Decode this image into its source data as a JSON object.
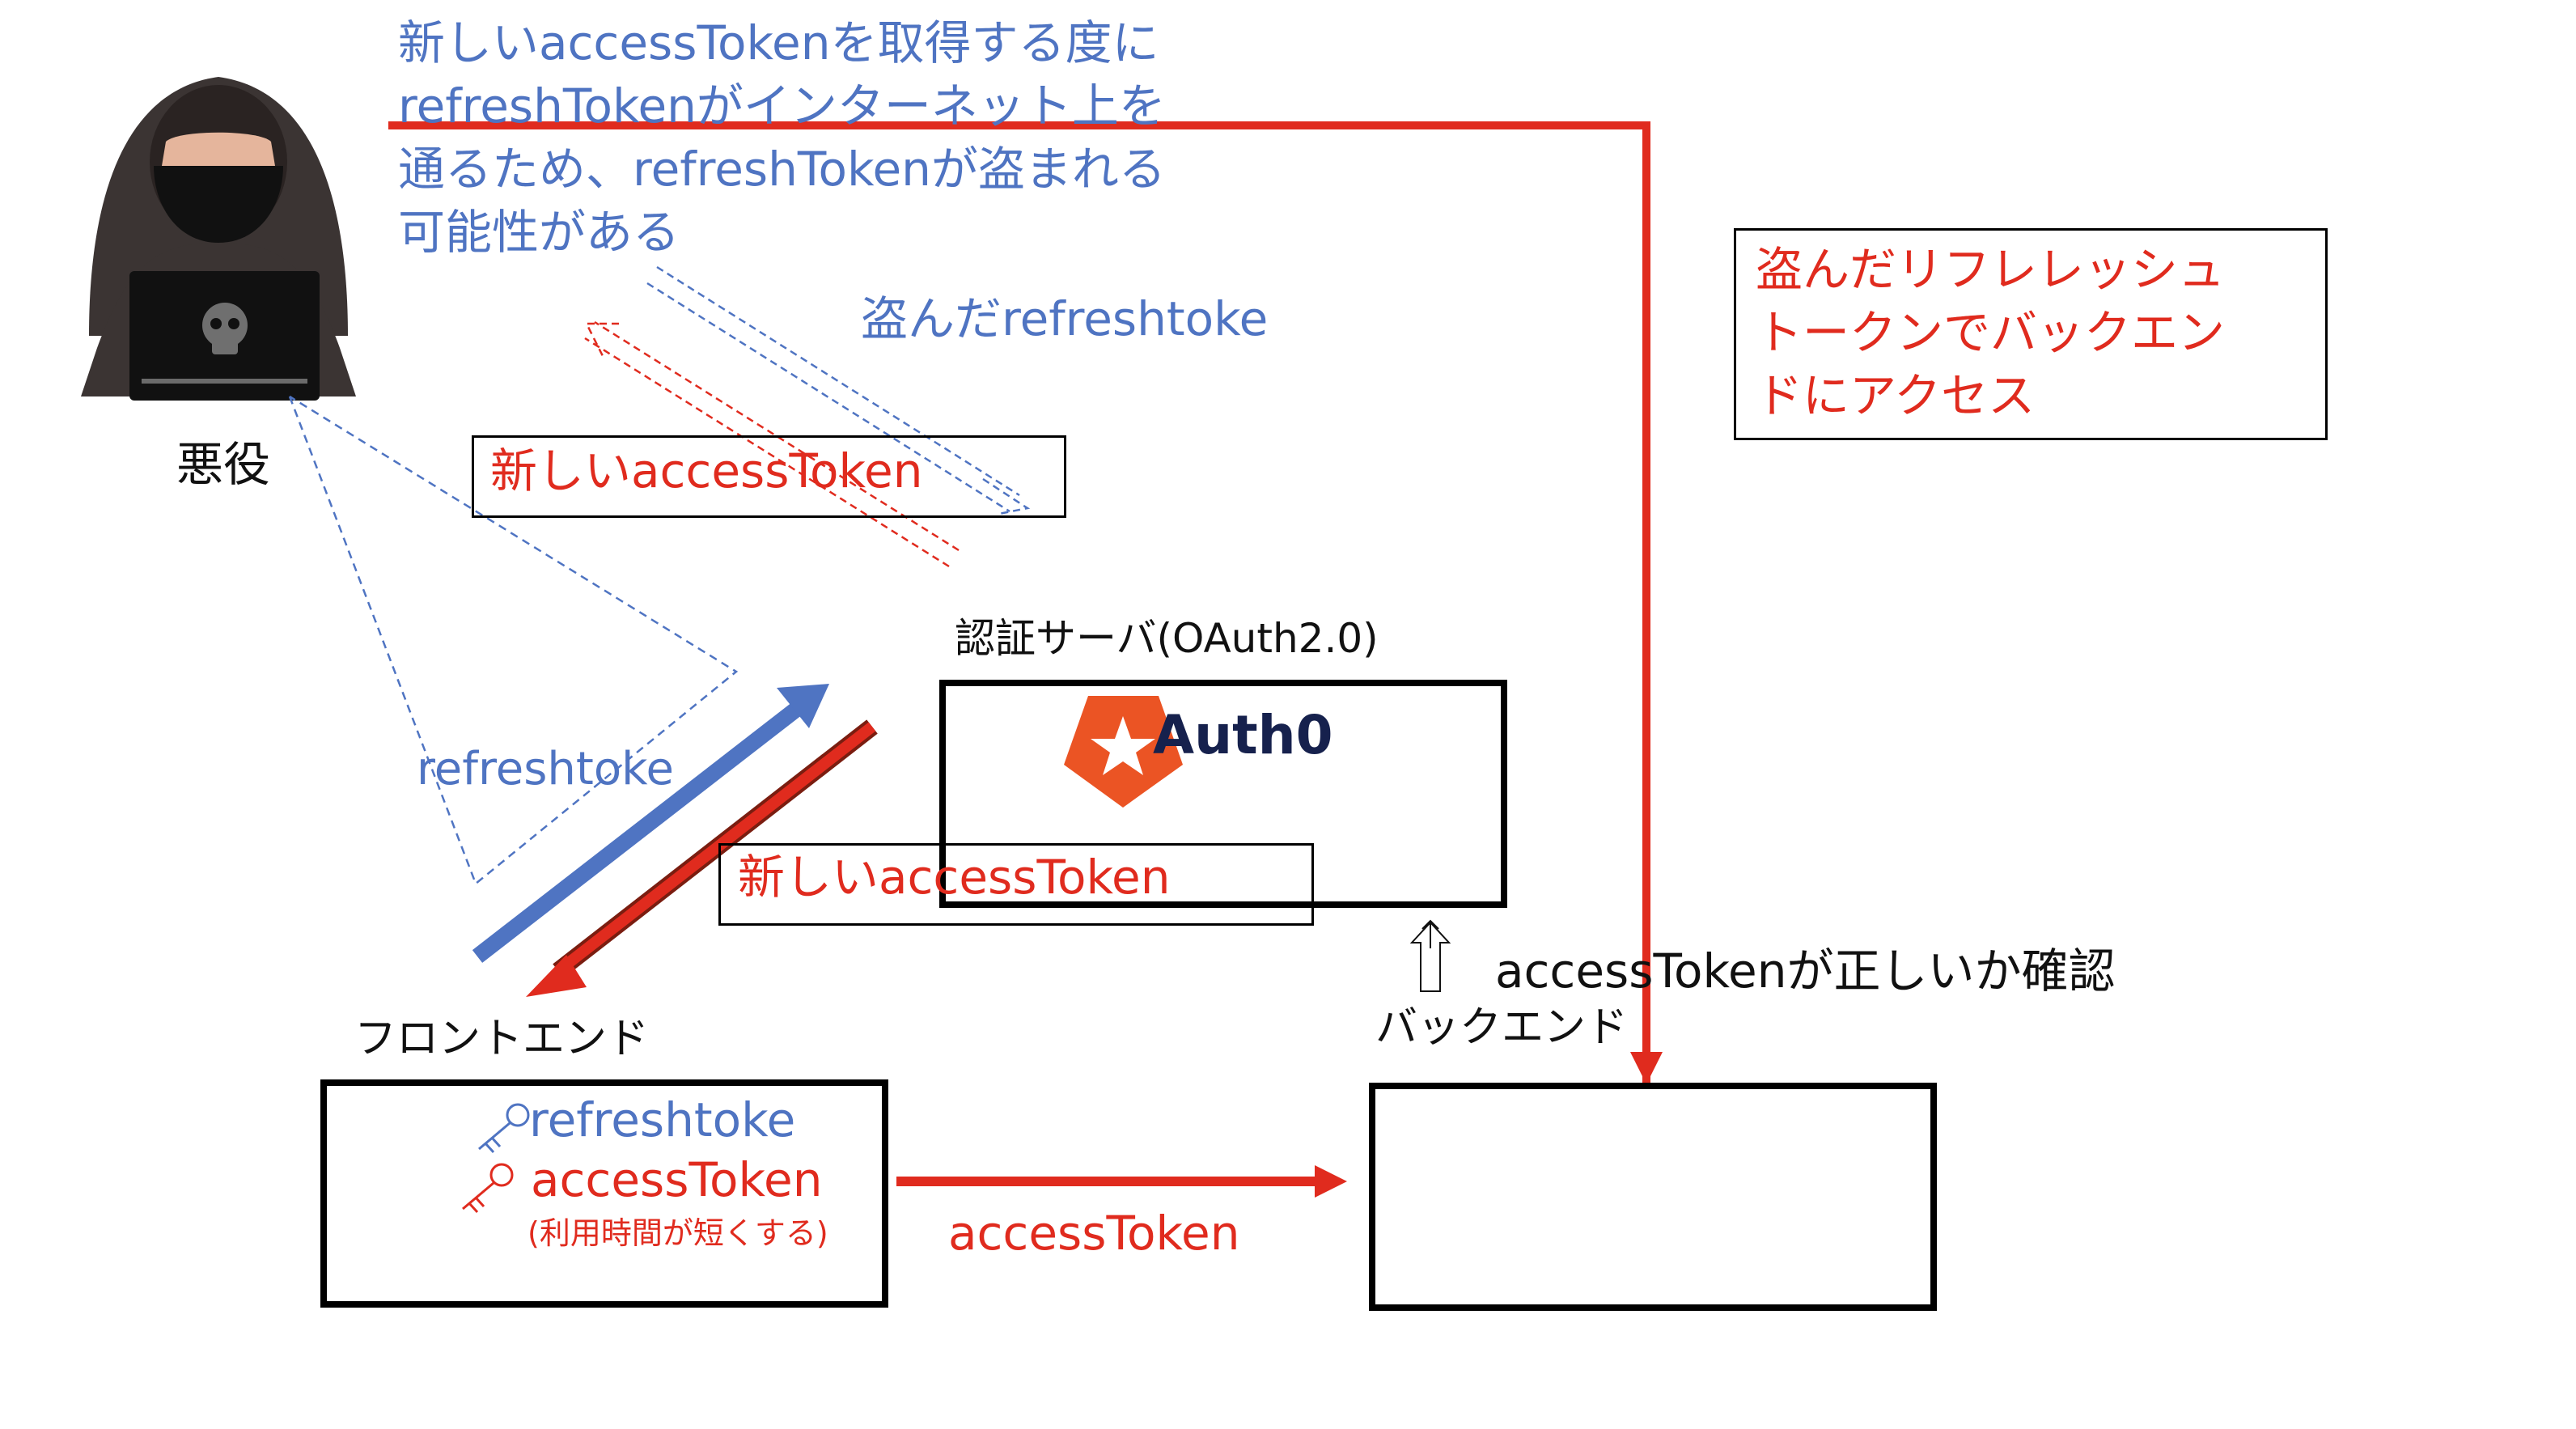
{
  "colors": {
    "blue": "#4f74c2",
    "red": "#e02b1e",
    "dark_red": "#7a1d10",
    "black": "#000000",
    "auth0_orange": "#eb5424",
    "auth0_navy": "#16214d"
  },
  "villain": {
    "label": "悪役"
  },
  "note_top": {
    "lines": [
      "新しいaccessTokenを取得する度に",
      "refreshTokenがインターネット上を",
      "通るため、refreshTokenが盗まれる",
      "可能性がある"
    ]
  },
  "stolen_refresh_label": "盗んだrefreshtoke",
  "new_access_token_top": "新しいaccessToken",
  "attack_note": {
    "lines": [
      "盗んだリフレレッシュ",
      "トークンでバックエン",
      "ドにアクセス"
    ]
  },
  "auth_server": {
    "label": "認証サーバ(OAuth2.0)",
    "logo_text": "Auth0"
  },
  "refresh_label": "refreshtoke",
  "new_access_token_mid": "新しいaccessToken",
  "verify_label": "accessTokenが正しいか確認",
  "backend": {
    "label": "バックエンド"
  },
  "frontend": {
    "label": "フロントエンド",
    "refresh_item": "refreshtoke",
    "access_item": "accessToken",
    "access_note": "(利用時間が短くする)"
  },
  "bottom_arrow_label": "accessToken",
  "icons": [
    "hooded-hacker-icon",
    "skull-icon",
    "key-icon",
    "auth0-star-icon",
    "up-arrow-icon"
  ]
}
